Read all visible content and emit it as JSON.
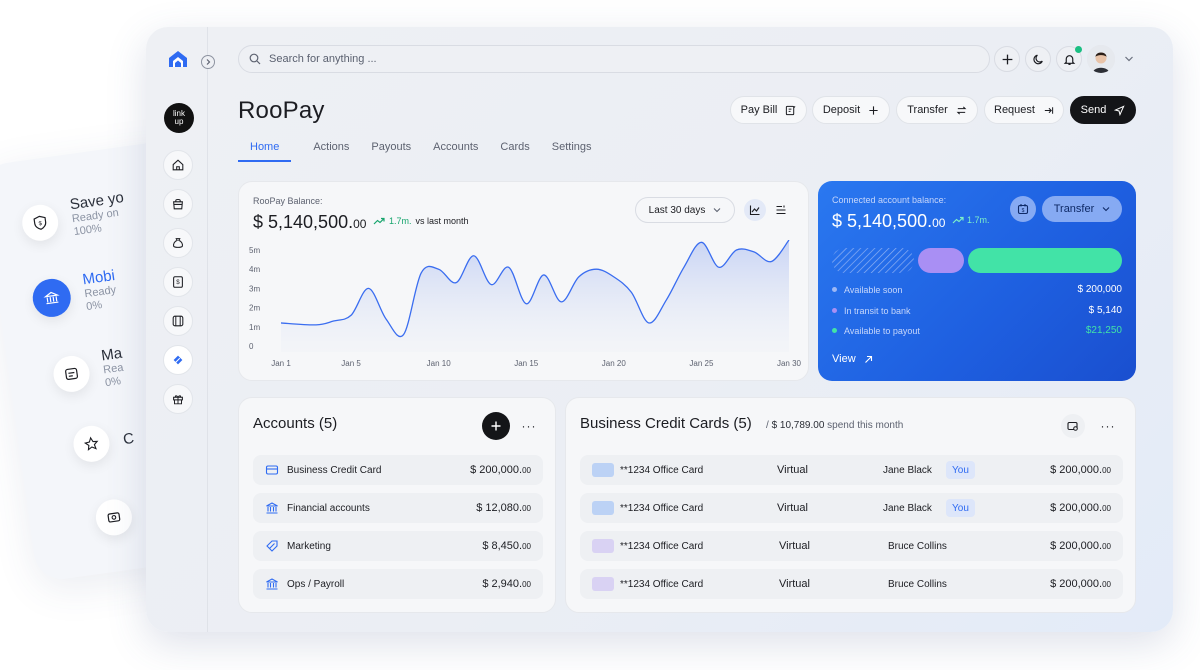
{
  "back_panel": {
    "items": [
      {
        "title": "Save yo",
        "sub": "Ready on\n100%"
      },
      {
        "title": "Mobi",
        "sub": "Ready\n0%"
      },
      {
        "title": "Ma",
        "sub": "Rea\n0%"
      },
      {
        "title": "C",
        "sub": ""
      },
      {
        "title": "",
        "sub": ""
      }
    ]
  },
  "sidebar": {
    "brand_badge": "link\nup",
    "nav": [
      "home",
      "bag",
      "bag-dollar",
      "invoice",
      "receipt",
      "cards",
      "gift"
    ]
  },
  "topbar": {
    "search_placeholder": "Search for anything ..."
  },
  "header": {
    "title": "RooPay",
    "actions": [
      {
        "label": "Pay Bill",
        "icon": "bill-icon"
      },
      {
        "label": "Deposit",
        "icon": "plus-icon"
      },
      {
        "label": "Transfer",
        "icon": "transfer-icon"
      },
      {
        "label": "Request",
        "icon": "request-icon"
      },
      {
        "label": "Send",
        "icon": "send-icon"
      }
    ],
    "tabs": [
      "Home",
      "Actions",
      "Payouts",
      "Accounts",
      "Cards",
      "Settings"
    ],
    "active_tab": "Home"
  },
  "balance_card": {
    "label": "RooPay Balance:",
    "amount_main": "$ 5,140,500.",
    "amount_cents": "00",
    "delta": "1.7m.",
    "delta_suffix": "vs last month",
    "range": "Last 30 days"
  },
  "chart_data": {
    "type": "area",
    "title": "",
    "xlabel": "",
    "ylabel": "",
    "x_ticks": [
      "Jan 1",
      "Jan 5",
      "Jan 10",
      "Jan 15",
      "Jan 20",
      "Jan 25",
      "Jan 30"
    ],
    "y_ticks": [
      "0",
      "1m",
      "2m",
      "3m",
      "4m",
      "5m"
    ],
    "ylim": [
      0,
      5
    ],
    "x": [
      1,
      3,
      4,
      5,
      6,
      7,
      8,
      9,
      10,
      11,
      12,
      13,
      14,
      15,
      16,
      17,
      18,
      19,
      20,
      21,
      22,
      23,
      24,
      25,
      26,
      27,
      28,
      29,
      30
    ],
    "values": [
      1.2,
      1.1,
      1.3,
      1.6,
      3.0,
      1.4,
      0.6,
      3.8,
      4.0,
      3.3,
      4.7,
      3.2,
      4.1,
      2.2,
      3.7,
      2.3,
      3.6,
      4.0,
      3.6,
      2.8,
      1.2,
      2.4,
      4.1,
      5.4,
      4.1,
      5.0,
      4.9,
      4.4,
      6.5
    ],
    "color": "#3a6df0"
  },
  "connected_card": {
    "label": "Connected account balance:",
    "amount_main": "$ 5,140,500.",
    "amount_cents": "00",
    "delta": "1.7m.",
    "transfer_label": "Transfer",
    "rows": [
      {
        "label": "Available soon",
        "value": "$ 200,000",
        "dot": "#9db7f5"
      },
      {
        "label": "In transit to bank",
        "value": "$ 5,140",
        "dot": "#a98ff4"
      },
      {
        "label": "Available to payout",
        "value": "$21,250",
        "dot": "#42e3a7"
      }
    ],
    "view_label": "View",
    "colors": {
      "transit": "#a98ff4",
      "payout": "#42e3a7"
    }
  },
  "accounts": {
    "title": "Accounts (5)",
    "rows": [
      {
        "name": "Business Credit Card",
        "amount": "$ 200,000.",
        "cents": "00",
        "icon": "credit-card-icon"
      },
      {
        "name": "Financial accounts",
        "amount": "$ 12,080.",
        "cents": "00",
        "icon": "bank-icon"
      },
      {
        "name": "Marketing",
        "amount": "$ 8,450.",
        "cents": "00",
        "icon": "tag-icon"
      },
      {
        "name": "Ops / Payroll",
        "amount": "$ 2,940.",
        "cents": "00",
        "icon": "bank-icon"
      }
    ]
  },
  "business_cards": {
    "title": "Business Credit Cards (5)",
    "spend_prefix": "/",
    "spend_amount": "$ 10,789.00",
    "spend_suffix": "spend this month",
    "rows": [
      {
        "number": "**1234 Office Card",
        "type": "Virtual",
        "holder": "Jane Black",
        "badge": "You",
        "amount": "$ 200,000.",
        "cents": "00",
        "card_color": "#bcd2f5"
      },
      {
        "number": "**1234 Office Card",
        "type": "Virtual",
        "holder": "Jane Black",
        "badge": "You",
        "amount": "$ 200,000.",
        "cents": "00",
        "card_color": "#bcd2f5"
      },
      {
        "number": "**1234 Office Card",
        "type": "Virtual",
        "holder": "Bruce Collins",
        "badge": "",
        "amount": "$ 200,000.",
        "cents": "00",
        "card_color": "#d9d2f3"
      },
      {
        "number": "**1234 Office Card",
        "type": "Virtual",
        "holder": "Bruce Collins",
        "badge": "",
        "amount": "$ 200,000.",
        "cents": "00",
        "card_color": "#d9d2f3"
      }
    ]
  }
}
